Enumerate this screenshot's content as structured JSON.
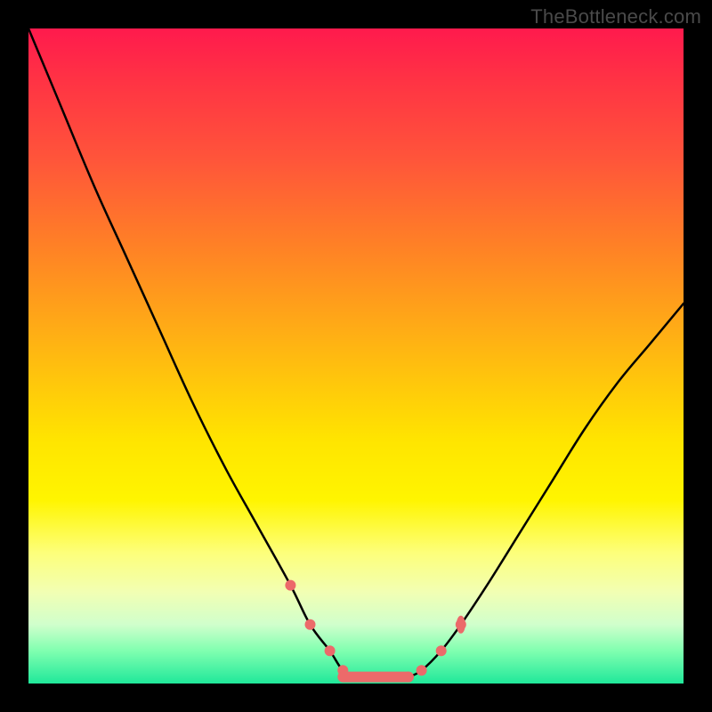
{
  "watermark": {
    "text": "TheBottleneck.com"
  },
  "chart_data": {
    "type": "line",
    "title": "",
    "xlabel": "",
    "ylabel": "",
    "xlim": [
      0,
      100
    ],
    "ylim": [
      0,
      100
    ],
    "annotations": [],
    "series": [
      {
        "name": "left-curve",
        "x": [
          0,
          5,
          10,
          15,
          20,
          25,
          30,
          35,
          40,
          43,
          46,
          48,
          50
        ],
        "y": [
          100,
          88,
          76,
          65,
          54,
          43,
          33,
          24,
          15,
          9,
          5,
          2,
          1
        ],
        "color": "#000000"
      },
      {
        "name": "right-curve",
        "x": [
          58,
          60,
          63,
          66,
          70,
          75,
          80,
          85,
          90,
          95,
          100
        ],
        "y": [
          1,
          2,
          5,
          9,
          15,
          23,
          31,
          39,
          46,
          52,
          58
        ],
        "color": "#000000"
      },
      {
        "name": "left-highlight-dots",
        "x": [
          40,
          43,
          46,
          48
        ],
        "y": [
          15,
          9,
          5,
          2
        ],
        "color": "#ec6a6a"
      },
      {
        "name": "right-highlight-dots",
        "x": [
          58,
          60,
          63,
          66
        ],
        "y": [
          1,
          2,
          5,
          9
        ],
        "color": "#ec6a6a"
      },
      {
        "name": "bottom-band",
        "x": [
          48,
          50,
          52,
          54,
          56,
          58
        ],
        "y": [
          1,
          1,
          1,
          1,
          1,
          1
        ],
        "color": "#ec6a6a"
      }
    ]
  }
}
